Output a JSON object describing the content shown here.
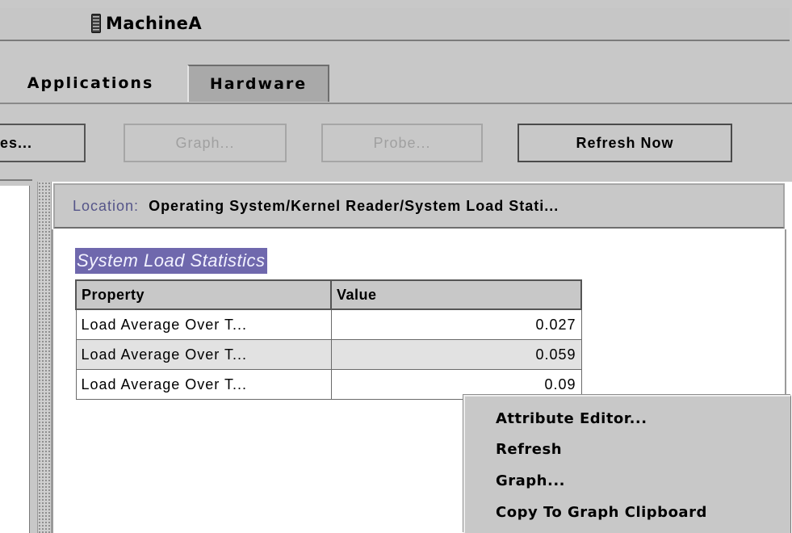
{
  "window": {
    "title": "MachineA",
    "icon": "server-icon"
  },
  "tabs": [
    {
      "label": "Applications",
      "active": false
    },
    {
      "label": "Hardware",
      "active": true
    }
  ],
  "toolbar": {
    "services_label": "es...",
    "graph_label": "Graph...",
    "probe_label": "Probe...",
    "refresh_label": "Refresh Now"
  },
  "location": {
    "label": "Location:",
    "path": "Operating System/Kernel Reader/System Load Stati..."
  },
  "section": {
    "title": "System Load Statistics"
  },
  "table": {
    "headers": [
      "Property",
      "Value"
    ],
    "rows": [
      {
        "property": "Load Average Over T...",
        "value": "0.027"
      },
      {
        "property": "Load Average Over T...",
        "value": "0.059"
      },
      {
        "property": "Load Average Over T...",
        "value": "0.09"
      }
    ]
  },
  "context_menu": {
    "items": [
      {
        "label": "Attribute Editor..."
      },
      {
        "label": "Refresh"
      },
      {
        "label": "Graph..."
      },
      {
        "label": "Copy To Graph Clipboard"
      }
    ]
  },
  "colors": {
    "background": "#c8c8c8",
    "section_highlight": "#6f68ad",
    "location_label": "#555589"
  }
}
